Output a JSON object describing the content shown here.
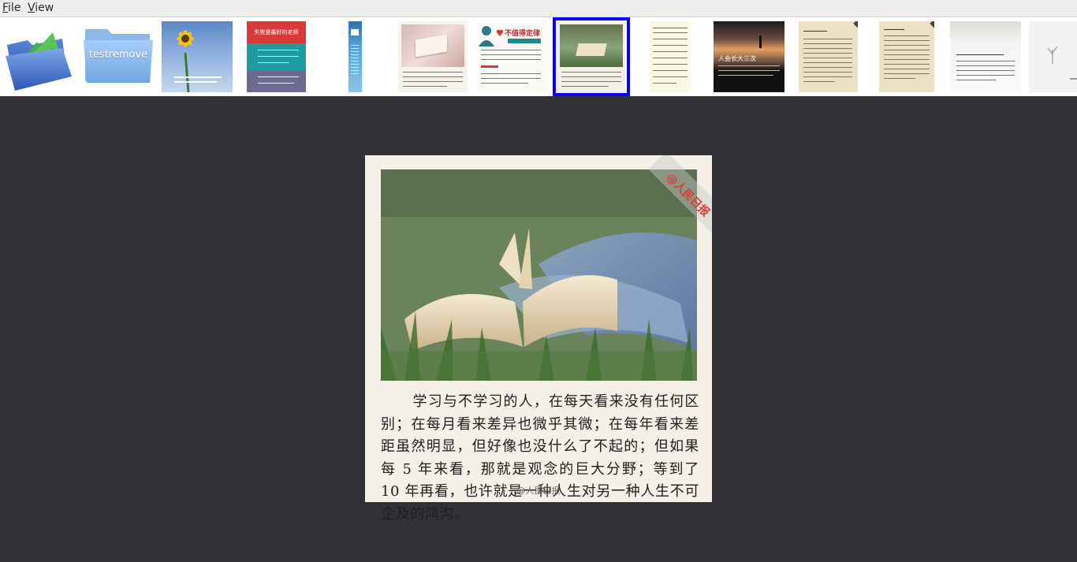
{
  "menu": {
    "file_accel": "F",
    "file_rest": "ile",
    "view_accel": "V",
    "view_rest": "iew"
  },
  "thumbnails": {
    "folder_label": "testremove",
    "t2_title": "失败是最好的老师",
    "t4_title": "不值得定律",
    "t8_title": "人会长大三次"
  },
  "viewer": {
    "watermark": "@人民日报",
    "caption": "学习与不学习的人，在每天看来没有任何区别；在每月看来差异也微乎其微；在每年看来差距虽然明显，但好像也没什么了不起的；但如果每 5 年来看，那就是观念的巨大分野；等到了 10 年再看，也许就是一种人生对另一种人生不可企及的鸿沟。",
    "credit": "@人民日报"
  },
  "colors": {
    "selection_outline": "#0a00f0",
    "viewer_background": "#323236",
    "menubar_background": "#ededec"
  },
  "icons": [
    "folder-up-icon",
    "folder-icon"
  ]
}
